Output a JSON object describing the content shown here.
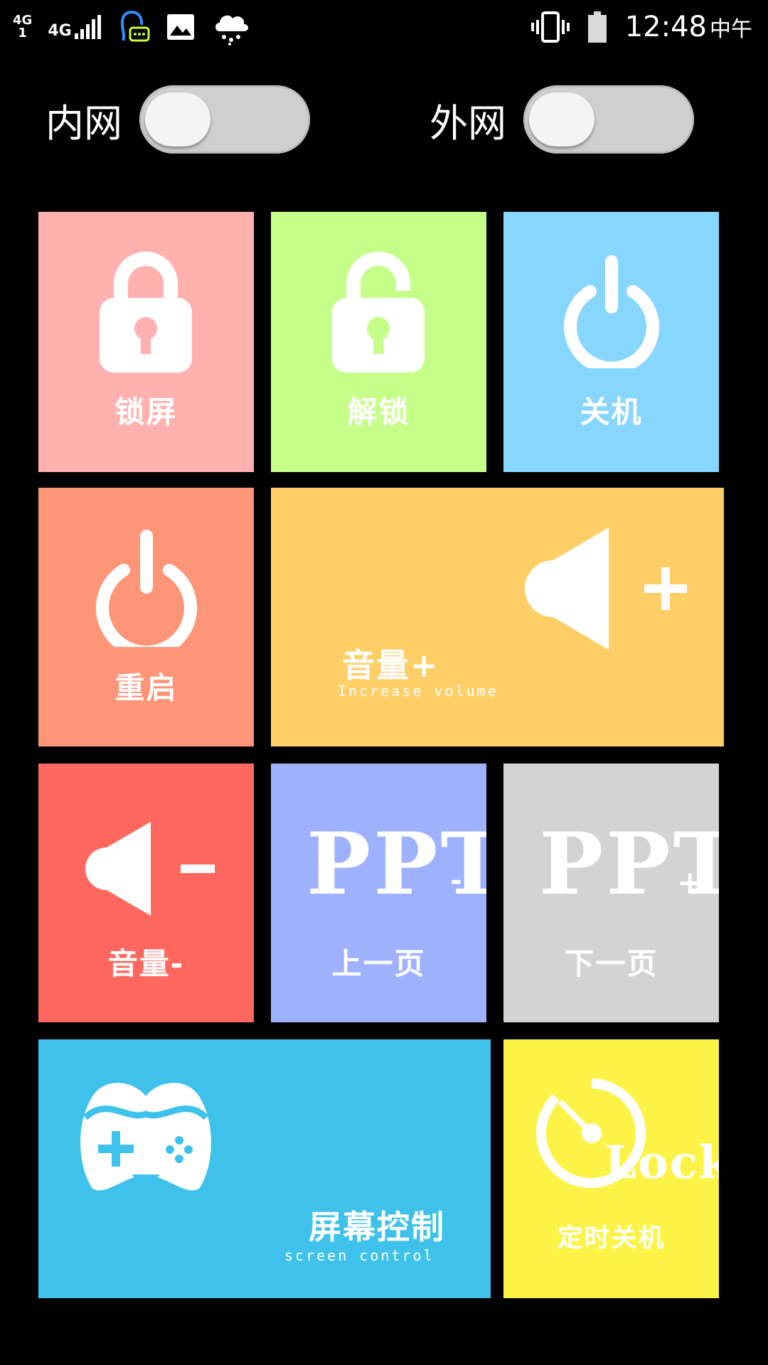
{
  "status_bar": {
    "network_left": "4G",
    "network_sub": "1",
    "network_type": "4G",
    "time": "12:48",
    "am_pm": "中午",
    "icons": [
      "signal-icon",
      "chat-icon",
      "image-icon",
      "weather-icon",
      "vibrate-icon",
      "battery-icon"
    ]
  },
  "toggles": [
    {
      "label": "内网",
      "on": false
    },
    {
      "label": "外网",
      "on": false
    }
  ],
  "tiles": {
    "lock_screen": {
      "label": "锁屏",
      "color": "#ffb1b0"
    },
    "unlock": {
      "label": "解锁",
      "color": "#c6fe8a"
    },
    "shutdown": {
      "label": "关机",
      "color": "#87d6fe"
    },
    "restart": {
      "label": "重启",
      "color": "#ff9577"
    },
    "volume_up": {
      "label": "音量+",
      "sublabel": "Increase volume",
      "color": "#fecf67"
    },
    "volume_down": {
      "label": "音量-",
      "color": "#ff675f"
    },
    "ppt_prev": {
      "icon_text": "PPT",
      "icon_suffix": "-",
      "label": "上一页",
      "color": "#9eb1fe"
    },
    "ppt_next": {
      "icon_text": "PPT",
      "icon_suffix": "+",
      "label": "下一页",
      "color": "#d3d3d3"
    },
    "screen_control": {
      "label": "屏幕控制",
      "sublabel": "screen control",
      "color": "#3ec2ec"
    },
    "timed_shutdown": {
      "icon_text": "Lock",
      "label": "定时关机",
      "color": "#fcf346"
    }
  }
}
